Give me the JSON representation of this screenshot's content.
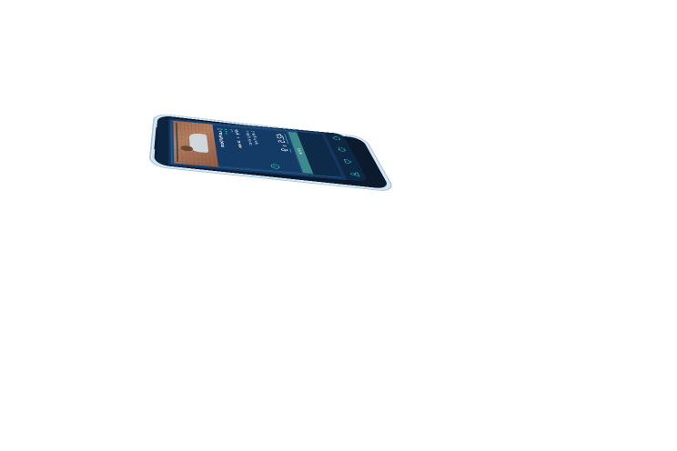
{
  "exercise": {
    "title": "Lat Pull Down",
    "stars": "★★★",
    "goal_label": "Goal",
    "goal_weight": "45 kg",
    "goal_x": "x",
    "goal_reps": "10 reps",
    "history": [
      "1: 45kg x 10 reps",
      "2: 45kg x 9 reps"
    ]
  },
  "input": {
    "weight": "42.5",
    "times": "x",
    "reps": "9"
  },
  "actions": {
    "finish_label": "Finish"
  },
  "nav": {
    "items": [
      "home-icon",
      "apple-icon",
      "heart-icon",
      "profile-icon"
    ]
  },
  "colors": {
    "accent": "#2fd1b0",
    "screen_bg": "#15365f",
    "finish_button": "#3d8a8c",
    "phone_frame": "#cfe3f2"
  }
}
